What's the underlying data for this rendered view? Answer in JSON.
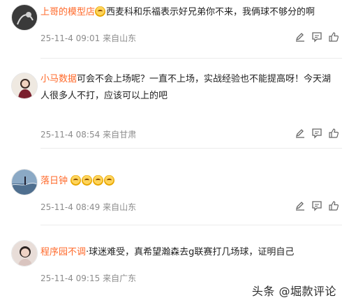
{
  "comments": [
    {
      "username": "上哥的模型店",
      "text": "西麦科和乐福表示好兄弟你不来，我俩球不够分的啊",
      "date": "25-11-4 09:01",
      "location": "来自山东",
      "has_emoji": true
    },
    {
      "username": "小马数据",
      "text": "可会不会上场呢？一直不上场，实战经验也不能提高呀！今天湖人很多人不打，应该可以上的吧",
      "date": "25-11-4 08:54",
      "location": "来自甘肃",
      "has_emoji": false
    },
    {
      "username": "落日钟",
      "text": "",
      "date": "25-11-4 08:49",
      "location": "来自山东",
      "emoji_count": 4
    },
    {
      "username": "程序园不调",
      "text": "·球迷难受，真希望瀚森去g联赛打几场球，证明自己",
      "date": "25-11-4 09:15",
      "location": "来自广东",
      "has_emoji": false
    }
  ],
  "icons": {
    "avatar_1": "avatar",
    "edit": "edit-icon",
    "comment": "comment-icon",
    "like": "like-icon"
  },
  "colors": {
    "username": "#ff6a2b",
    "text": "#1f1f1f",
    "meta": "#8c8c8c",
    "divider": "#ececec"
  },
  "watermark": "头条 @堀款评论"
}
